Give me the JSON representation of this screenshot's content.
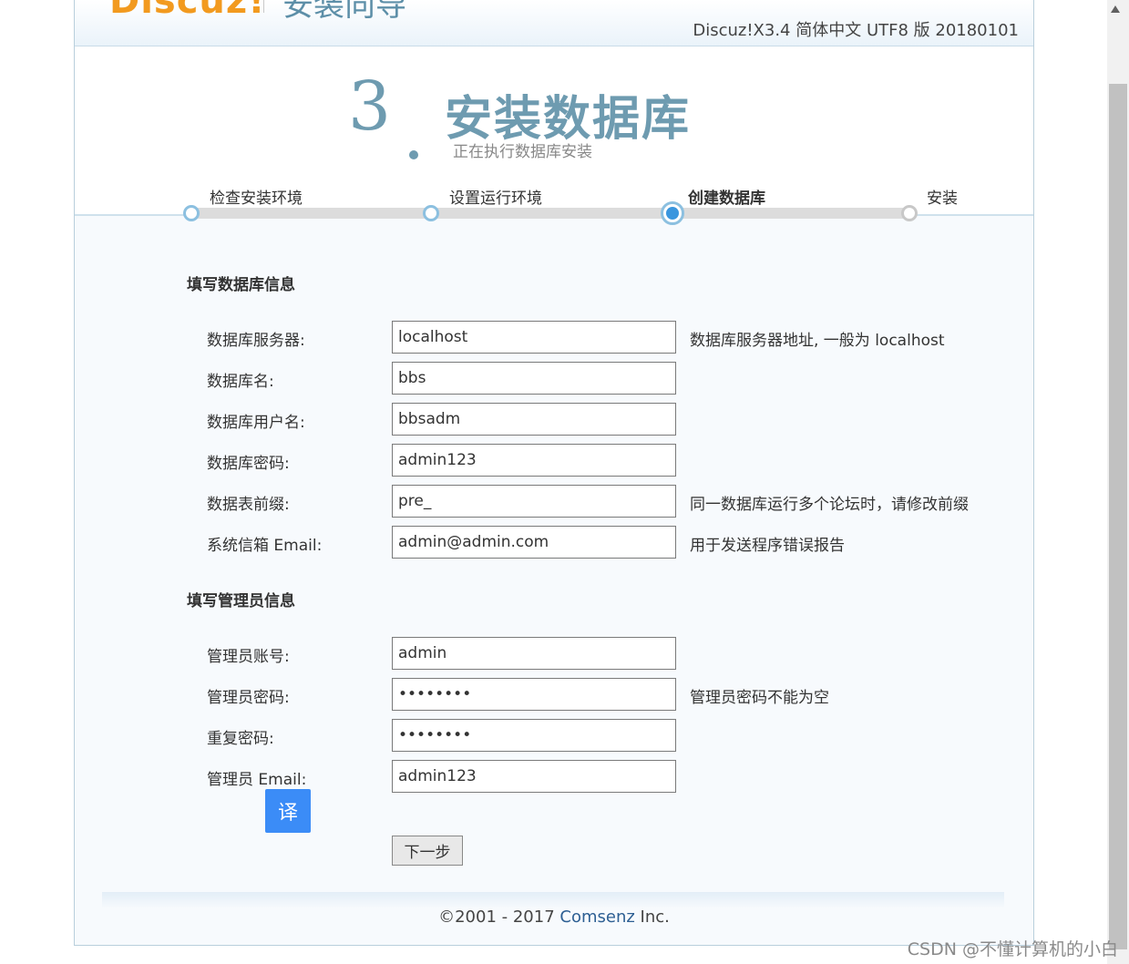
{
  "header": {
    "logo": "Discuz!",
    "wizard_title": "安装向导",
    "version": "Discuz!X3.4 简体中文 UTF8 版 20180101"
  },
  "step": {
    "number": "3",
    "title": "安装数据库",
    "description": "正在执行数据库安装"
  },
  "progress": {
    "steps": [
      {
        "label": "检查安装环境",
        "state": "done"
      },
      {
        "label": "设置运行环境",
        "state": "done"
      },
      {
        "label": "创建数据库",
        "state": "current"
      },
      {
        "label": "安装",
        "state": "pending"
      }
    ]
  },
  "db_section": {
    "title": "填写数据库信息",
    "rows": [
      {
        "label": "数据库服务器:",
        "value": "localhost",
        "hint": "数据库服务器地址, 一般为 localhost"
      },
      {
        "label": "数据库名:",
        "value": "bbs",
        "hint": ""
      },
      {
        "label": "数据库用户名:",
        "value": "bbsadm",
        "hint": ""
      },
      {
        "label": "数据库密码:",
        "value": "admin123",
        "hint": ""
      },
      {
        "label": "数据表前缀:",
        "value": "pre_",
        "hint": "同一数据库运行多个论坛时，请修改前缀"
      },
      {
        "label": "系统信箱 Email:",
        "value": "admin@admin.com",
        "hint": "用于发送程序错误报告"
      }
    ]
  },
  "admin_section": {
    "title": "填写管理员信息",
    "rows": [
      {
        "label": "管理员账号:",
        "value": "admin",
        "hint": ""
      },
      {
        "label": "管理员密码:",
        "value": "••••••••",
        "hint": "管理员密码不能为空"
      },
      {
        "label": "重复密码:",
        "value": "••••••••",
        "hint": ""
      },
      {
        "label": "管理员 Email:",
        "value": "admin123",
        "hint": ""
      }
    ]
  },
  "translate_button": "译",
  "next_button": "下一步",
  "footer": {
    "prefix": "©2001 - 2017 ",
    "company": "Comsenz",
    "suffix": " Inc."
  },
  "watermark": "CSDN @不懂计算机的小白"
}
